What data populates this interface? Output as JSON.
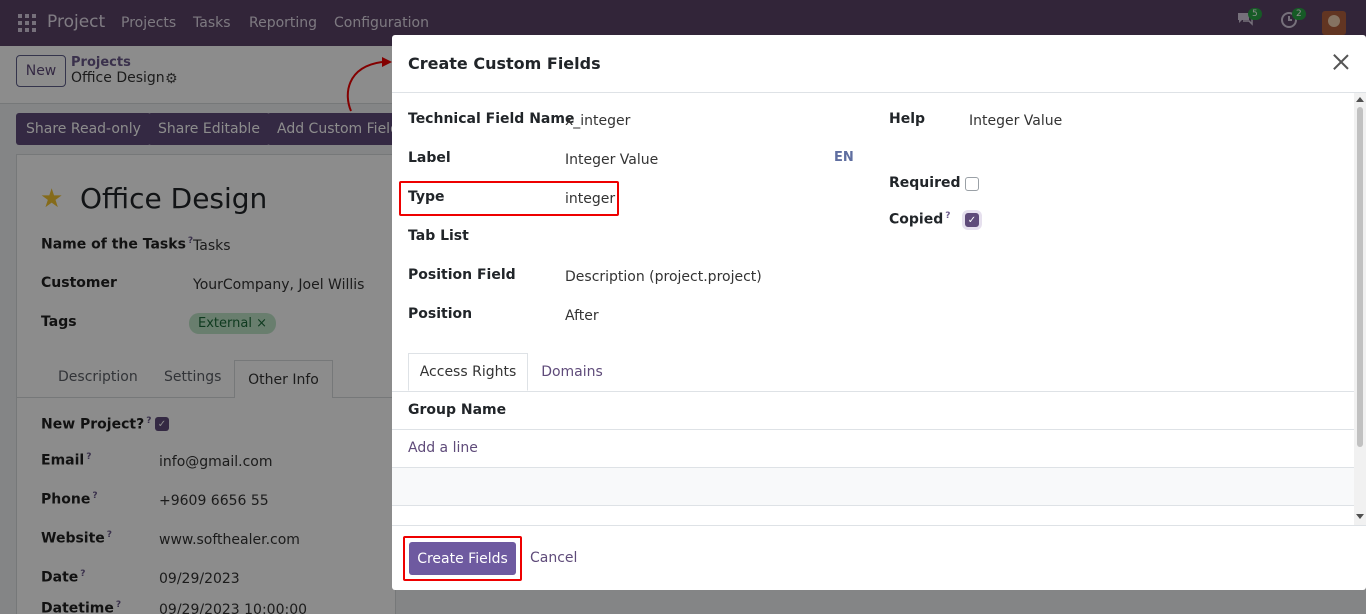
{
  "navbar": {
    "brand": "Project",
    "items": [
      "Projects",
      "Tasks",
      "Reporting",
      "Configuration"
    ],
    "messages_count": "5",
    "activities_count": "2"
  },
  "control": {
    "new_label": "New",
    "breadcrumb_parent": "Projects",
    "breadcrumb_current": "Office Design"
  },
  "actions": {
    "share_readonly": "Share Read-only",
    "share_editable": "Share Editable",
    "add_custom_field": "Add Custom Field"
  },
  "record": {
    "title": "Office Design",
    "fields": [
      {
        "label": "Name of the Tasks",
        "value": "Tasks"
      },
      {
        "label": "Customer",
        "value": "YourCompany, Joel Willis"
      },
      {
        "label": "Tags",
        "value": "External"
      }
    ],
    "tag_remove": "×",
    "tabs": [
      "Description",
      "Settings",
      "Other Info"
    ],
    "other_info": [
      {
        "label": "New Project?",
        "value": ""
      },
      {
        "label": "Email",
        "value": "info@gmail.com"
      },
      {
        "label": "Phone",
        "value": "+9609 6656 55"
      },
      {
        "label": "Website",
        "value": "www.softhealer.com"
      },
      {
        "label": "Date",
        "value": "09/29/2023"
      },
      {
        "label": "Datetime",
        "value": "09/29/2023 10:00:00"
      }
    ]
  },
  "modal": {
    "title": "Create Custom Fields",
    "technical_field_name_label": "Technical Field Name",
    "technical_field_name_value": "x_integer",
    "label_label": "Label",
    "label_value": "Integer Value",
    "lang": "EN",
    "type_label": "Type",
    "type_value": "integer",
    "tab_list_label": "Tab List",
    "position_field_label": "Position Field",
    "position_field_value": "Description (project.project)",
    "position_label": "Position",
    "position_value": "After",
    "help_label": "Help",
    "help_value": "Integer Value",
    "required_label": "Required",
    "required_checked": false,
    "copied_label": "Copied",
    "copied_checked": true,
    "tabs": [
      "Access Rights",
      "Domains"
    ],
    "grid_header": "Group Name",
    "add_line": "Add a line",
    "create_button": "Create Fields",
    "cancel_button": "Cancel"
  },
  "colors": {
    "navbar": "#5b4468",
    "primary": "#6e5aa0",
    "highlight": "#ee0000"
  }
}
